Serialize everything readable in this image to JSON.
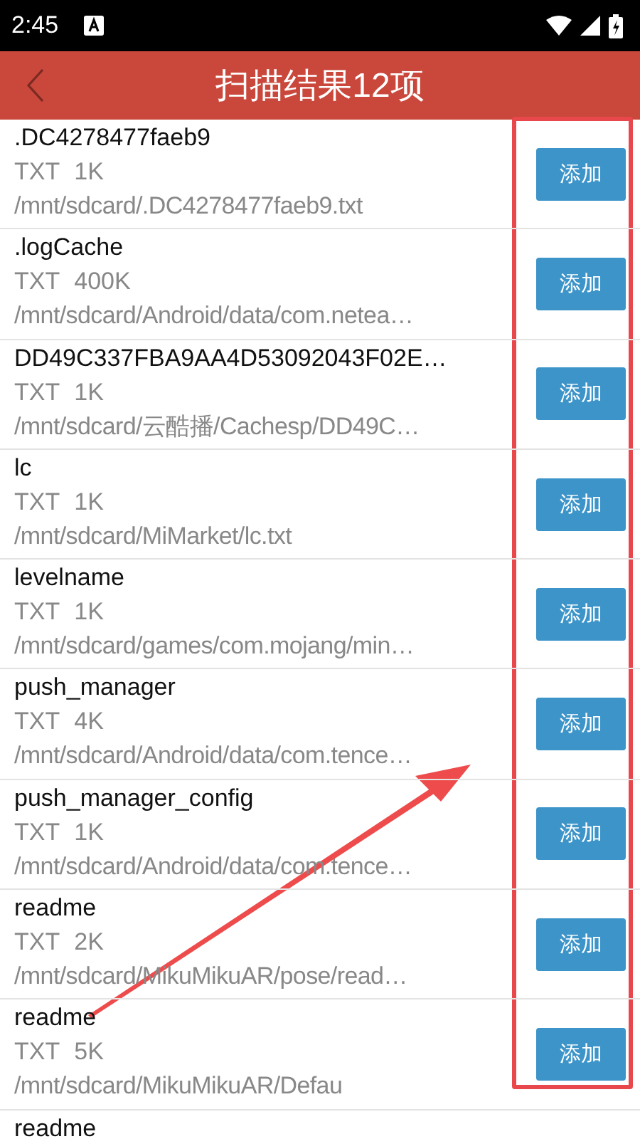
{
  "status_bar": {
    "time": "2:45"
  },
  "header": {
    "title": "扫描结果12项"
  },
  "files": [
    {
      "name": ".DC4278477faeb9",
      "type": "TXT",
      "size": "1K",
      "path": "/mnt/sdcard/.DC4278477faeb9.txt",
      "button": "添加"
    },
    {
      "name": ".logCache",
      "type": "TXT",
      "size": "400K",
      "path": "/mnt/sdcard/Android/data/com.netea…",
      "button": "添加"
    },
    {
      "name": "DD49C337FBA9AA4D53092043F02E…",
      "type": "TXT",
      "size": "1K",
      "path": "/mnt/sdcard/云酷播/Cachesp/DD49C…",
      "button": "添加"
    },
    {
      "name": "lc",
      "type": "TXT",
      "size": "1K",
      "path": "/mnt/sdcard/MiMarket/lc.txt",
      "button": "添加"
    },
    {
      "name": "levelname",
      "type": "TXT",
      "size": "1K",
      "path": "/mnt/sdcard/games/com.mojang/min…",
      "button": "添加"
    },
    {
      "name": "push_manager",
      "type": "TXT",
      "size": "4K",
      "path": "/mnt/sdcard/Android/data/com.tence…",
      "button": "添加"
    },
    {
      "name": "push_manager_config",
      "type": "TXT",
      "size": "1K",
      "path": "/mnt/sdcard/Android/data/com.tence…",
      "button": "添加"
    },
    {
      "name": "readme",
      "type": "TXT",
      "size": "2K",
      "path": "/mnt/sdcard/MikuMikuAR/pose/read…",
      "button": "添加"
    },
    {
      "name": "readme",
      "type": "TXT",
      "size": "5K",
      "path": "/mnt/sdcard/MikuMikuAR/Defau",
      "button": "添加"
    },
    {
      "name": "readme"
    }
  ],
  "annotations": {
    "frame": true,
    "arrow": true
  }
}
